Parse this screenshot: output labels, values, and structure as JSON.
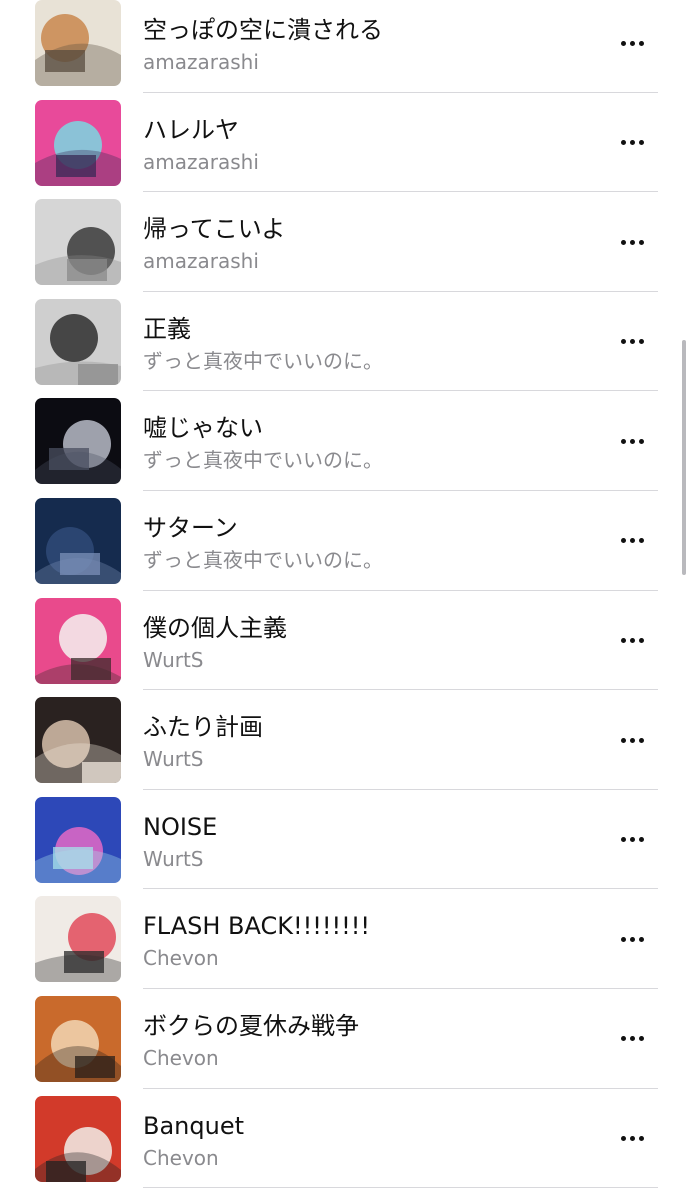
{
  "tracks": [
    {
      "title": "空っぽの空に潰される",
      "artist": "amazarashi",
      "artwork": "album-art-1",
      "colors": [
        "#e8e2d6",
        "#c9874d",
        "#5a4c40"
      ]
    },
    {
      "title": "ハレルヤ",
      "artist": "amazarashi",
      "artwork": "album-art-2",
      "colors": [
        "#e84a9a",
        "#7ad7e2",
        "#3a2a55"
      ]
    },
    {
      "title": "帰ってこいよ",
      "artist": "amazarashi",
      "artwork": "album-art-3",
      "colors": [
        "#d6d6d6",
        "#3a3a3a",
        "#8a8a8a"
      ]
    },
    {
      "title": "正義",
      "artist": "ずっと真夜中でいいのに。",
      "artwork": "album-art-4",
      "colors": [
        "#cfcfcf",
        "#2e2e2e",
        "#8c8c8c"
      ]
    },
    {
      "title": "嘘じゃない",
      "artist": "ずっと真夜中でいいのに。",
      "artwork": "album-art-5",
      "colors": [
        "#0c0c12",
        "#b8bcc8",
        "#4a4f60"
      ]
    },
    {
      "title": "サターン",
      "artist": "ずっと真夜中でいいのに。",
      "artwork": "album-art-6",
      "colors": [
        "#152b4e",
        "#2f4a78",
        "#7b90b8"
      ]
    },
    {
      "title": "僕の個人主義",
      "artist": "WurtS",
      "artwork": "album-art-7",
      "colors": [
        "#e94a8c",
        "#f5f2f0",
        "#3b2b2b"
      ]
    },
    {
      "title": "ふたり計画",
      "artist": "WurtS",
      "artwork": "album-art-8",
      "colors": [
        "#2a2220",
        "#d7c0ac",
        "#f1e7dd"
      ]
    },
    {
      "title": "NOISE",
      "artist": "WurtS",
      "artwork": "album-art-9",
      "colors": [
        "#2d48b8",
        "#e46ac6",
        "#a6e2ea"
      ]
    },
    {
      "title": "FLASH BACK!!!!!!!!",
      "artist": "Chevon",
      "artwork": "album-art-10",
      "colors": [
        "#f0ebe6",
        "#e24b5a",
        "#2a2a2a"
      ]
    },
    {
      "title": "ボクらの夏休み戦争",
      "artist": "Chevon",
      "artwork": "album-art-11",
      "colors": [
        "#c96a2c",
        "#f2d6b4",
        "#2a2019"
      ]
    },
    {
      "title": "Banquet",
      "artist": "Chevon",
      "artwork": "album-art-12",
      "colors": [
        "#d23a2a",
        "#f2efe9",
        "#222222"
      ]
    }
  ],
  "more_icon": "ellipsis-icon"
}
